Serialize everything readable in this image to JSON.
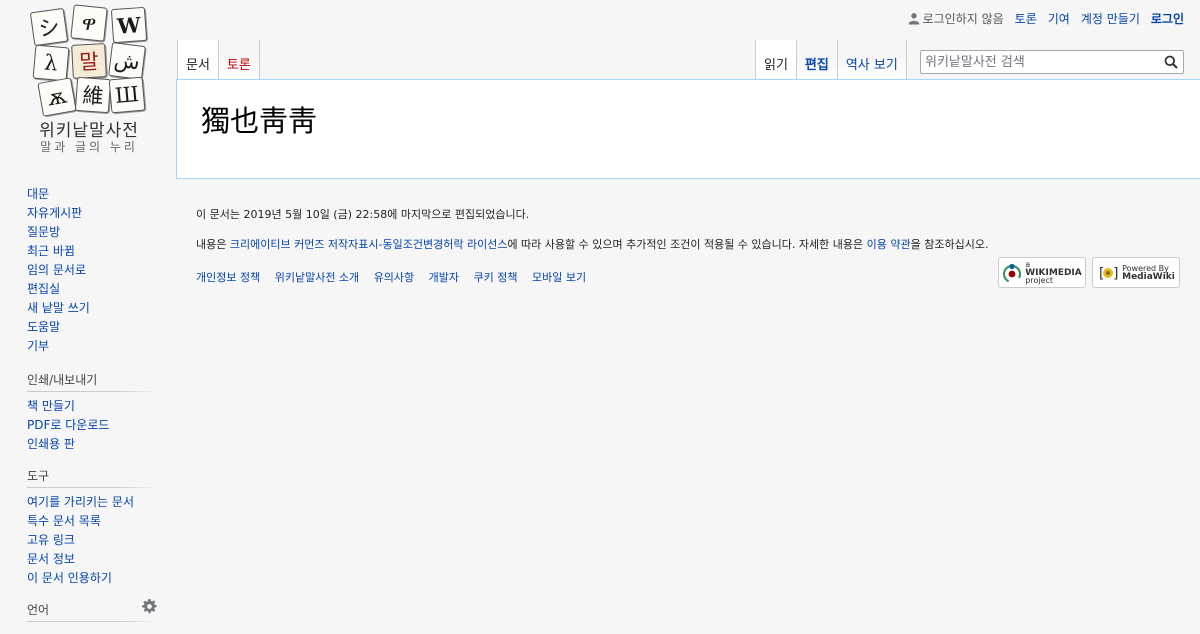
{
  "logo": {
    "tiles": [
      "シ",
      "ዋ",
      "W",
      "λ",
      "말",
      "ش",
      "維",
      "ѫ",
      "Ш"
    ],
    "title": "위키낱말사전",
    "slogan": "말과 글의 누리"
  },
  "personal": {
    "anon": "로그인하지 않음",
    "talk": "토론",
    "contributions": "기여",
    "create_account": "계정 만들기",
    "login": "로그인"
  },
  "tabs": {
    "article": "문서",
    "talk": "토론",
    "read": "읽기",
    "edit": "편집",
    "history": "역사 보기"
  },
  "search": {
    "placeholder": "위키낱말사전 검색"
  },
  "page": {
    "title": "獨也靑靑"
  },
  "sidebar": {
    "navigation": [
      "대문",
      "자유게시판",
      "질문방",
      "최근 바뀜",
      "임의 문서로",
      "편집실",
      "새 낱말 쓰기",
      "도움말",
      "기부"
    ],
    "print": {
      "heading": "인쇄/내보내기",
      "items": [
        "책 만들기",
        "PDF로 다운로드",
        "인쇄용 판"
      ]
    },
    "tools": {
      "heading": "도구",
      "items": [
        "여기를 가리키는 문서",
        "특수 문서 목록",
        "고유 링크",
        "문서 정보",
        "이 문서 인용하기"
      ]
    },
    "languages": {
      "heading": "언어"
    }
  },
  "footer": {
    "lastmod": "이 문서는 2019년 5월 10일 (금) 22:58에 마지막으로 편집되었습니다.",
    "copyright_pre": "내용은 ",
    "copyright_link": "크리에이티브 커먼즈 저작자표시-동일조건변경허락 라이선스",
    "copyright_mid": "에 따라 사용할 수 있으며 추가적인 조건이 적용될 수 있습니다. 자세한 내용은 ",
    "terms_link": "이용 약관",
    "copyright_post": "을 참조하십시오.",
    "places": [
      "개인정보 정책",
      "위키낱말사전 소개",
      "유의사항",
      "개발자",
      "쿠키 정책",
      "모바일 보기"
    ],
    "icons": {
      "wikimedia_top": "a",
      "wikimedia_name": "WIKIMEDIA",
      "wikimedia_sub": "project",
      "mediawiki_top": "Powered By",
      "mediawiki_name": "MediaWiki"
    }
  },
  "colors": {
    "link": "#0645ad",
    "redlink": "#ba0000",
    "content_border": "#a7d7f9",
    "background": "#f6f6f6"
  }
}
